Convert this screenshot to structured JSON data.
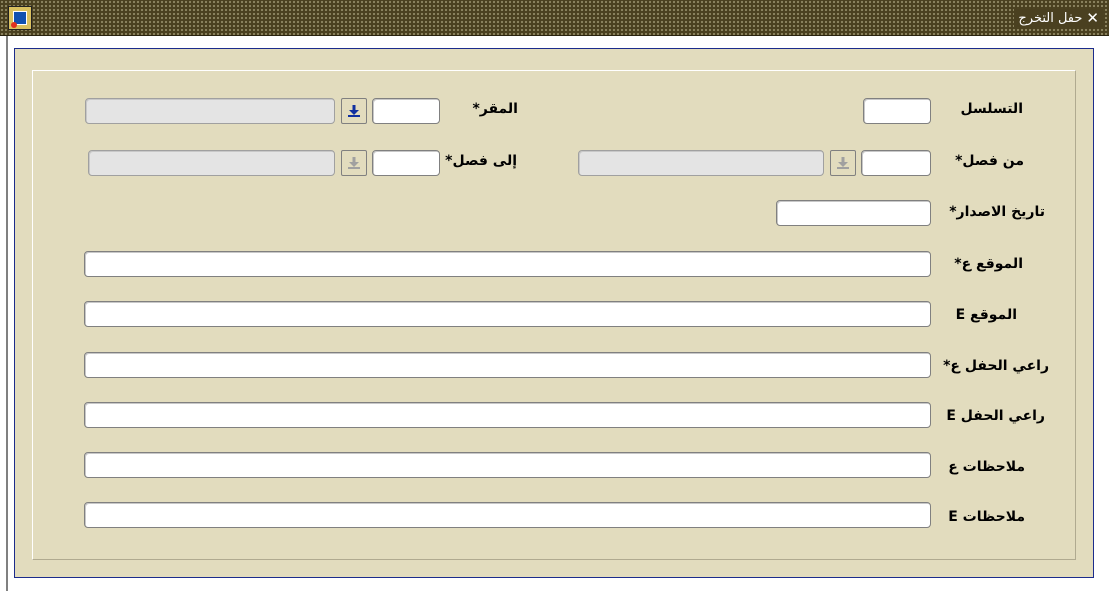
{
  "window": {
    "title": "حفل التخرج",
    "close_glyph": "✕"
  },
  "form": {
    "labels": {
      "sequence": "التسلسل",
      "headquarters": "المقر*",
      "from_semester": "من فصل*",
      "to_semester": "إلى فصل*",
      "issue_date": "تاريخ الاصدار*",
      "location_ar": "الموقع ع*",
      "location_en": "الموقع E",
      "sponsor_ar": "راعي الحفل ع*",
      "sponsor_en": "راعي الحفل E",
      "notes_ar": "ملاحظات ع",
      "notes_en": "ملاحظات E"
    },
    "values": {
      "sequence": "",
      "headquarters_code": "",
      "headquarters_name": "",
      "from_semester_code": "",
      "from_semester_name": "",
      "to_semester_code": "",
      "to_semester_name": "",
      "issue_date": "",
      "location_ar": "",
      "location_en": "",
      "sponsor_ar": "",
      "sponsor_en": "",
      "notes_ar": "",
      "notes_en": ""
    },
    "lov_icon": "download-arrow-icon"
  },
  "colors": {
    "titlebar": "#4a4020",
    "canvas": "#e2dcbe",
    "frame_border": "#1c2c8c",
    "lov_arrow_active": "#1030a0",
    "lov_arrow_disabled": "#a0a0a0"
  }
}
